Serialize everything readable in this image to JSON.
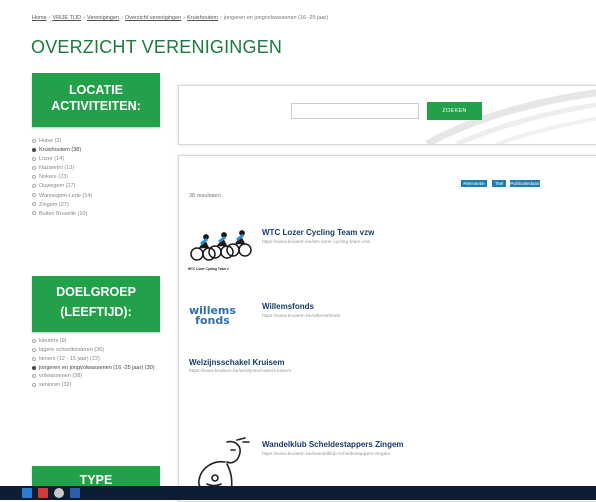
{
  "breadcrumb": {
    "items": [
      "Home",
      "VRIJE TIJD",
      "Verenigingen",
      "Overzicht verenigingen",
      "Kruishoutem",
      "jongeren en jongvolwassenen (16 -25 jaar)"
    ],
    "separator": "›"
  },
  "page_title": "OVERZICHT VERENIGINGEN",
  "sidebar": {
    "locatie_heading": [
      "LOCATIE",
      "ACTIVITEITEN:"
    ],
    "locatie_items": [
      {
        "label": "Huise (2)",
        "selected": false
      },
      {
        "label": "Kruishoutem (38)",
        "selected": true
      },
      {
        "label": "Lozer (14)",
        "selected": false
      },
      {
        "label": "Nazaretm (13)",
        "selected": false
      },
      {
        "label": "Nokere (23)",
        "selected": false
      },
      {
        "label": "Ouwegem (27)",
        "selected": false
      },
      {
        "label": "Wannegem-Lede (14)",
        "selected": false
      },
      {
        "label": "Zingem (27)",
        "selected": false
      },
      {
        "label": "Buiten Bruxelle (10)",
        "selected": false
      }
    ],
    "doelgroep_heading": [
      "DOELGROEP",
      "(LEEFTIJD):"
    ],
    "doelgroep_items": [
      {
        "label": "kleuters (9)",
        "selected": false
      },
      {
        "label": "lagere schoolkinderen (36)",
        "selected": false
      },
      {
        "label": "tieners (12 - 15 jaar) (22)",
        "selected": false
      },
      {
        "label": "jongeren en jongvolwassenen (16 -25 jaar) (30)",
        "selected": true
      },
      {
        "label": "volwassenen (38)",
        "selected": false
      },
      {
        "label": "senioren (32)",
        "selected": false
      }
    ],
    "type_heading": "TYPE"
  },
  "search": {
    "placeholder": "",
    "button_label": "ZOEKEN"
  },
  "results": {
    "count_text": "38 resultaten",
    "sort_buttons": [
      "Relevantie",
      "Titel",
      "Publicatiedatum"
    ],
    "items": [
      {
        "title": "WTC Lozer Cycling Team vzw",
        "url": "https://www.kruisem.be/wtc-lozer-cycling-team-vzw",
        "logo": "cycling-team-logo",
        "logo_caption": "WTC Lozer Cycling Team v"
      },
      {
        "title": "Willemsfonds",
        "url": "https://www.kruisem.be/willemsfonds",
        "logo": "willemsfonds-logo",
        "logo_text": [
          "willems",
          "fonds"
        ]
      },
      {
        "title": "Welzijnsschakel Kruisem",
        "url": "https://www.kruisem.be/welzijnsschakel-kruisem",
        "logo": ""
      },
      {
        "title": "Wandelklub Scheldestappers Zingem",
        "url": "https://www.kruisem.be/wandelklub-scheldestappers-zingem",
        "logo": "hiker-logo"
      }
    ]
  },
  "colors": {
    "accent_green": "#22a14a",
    "title_green": "#1d7a3e",
    "sort_blue": "#1a7fb0",
    "result_title": "#1a3a6b",
    "taskbar": "#0d1d33"
  },
  "taskbar": {
    "icons": [
      "start-icon",
      "app-icon-red",
      "browser-icon",
      "app-icon-blue"
    ]
  }
}
